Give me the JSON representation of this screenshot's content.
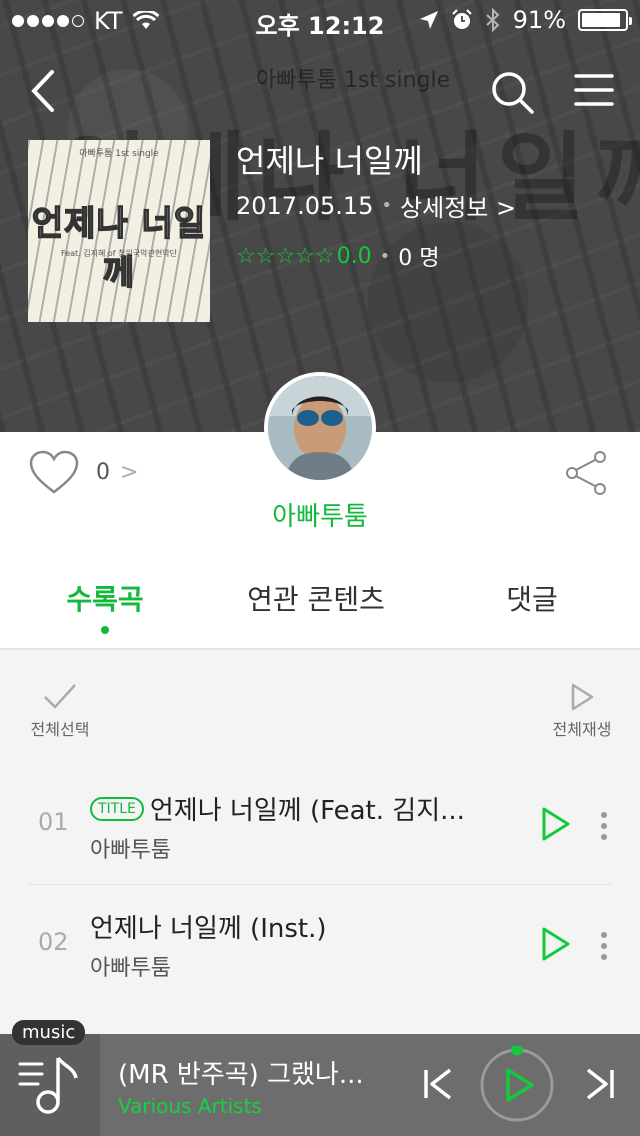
{
  "status_bar": {
    "carrier": "KT",
    "time": "오후 12:12",
    "battery": "91%",
    "battery_level": 0.91
  },
  "hero": {
    "subtitle": "아빠투툼 1st single",
    "background_text": "언제나 너일께"
  },
  "album": {
    "cover": {
      "top_text": "아빠투툼 1st single",
      "title": "언제나 너일께",
      "feat": "Feat. 김지혜 of 창원국악관현악단"
    },
    "title": "언제나 너일께",
    "release_date": "2017.05.15",
    "details_link": "상세정보 >",
    "rating": {
      "stars": "☆☆☆☆☆",
      "score": "0.0",
      "count": "0 명",
      "max": 5,
      "value": 0
    }
  },
  "social": {
    "like_count": "0",
    "like_arrow": ">",
    "artist": "아빠투툼"
  },
  "tabs": [
    {
      "label": "수록곡",
      "active": true
    },
    {
      "label": "연관 콘텐츠",
      "active": false
    },
    {
      "label": "댓글",
      "active": false
    }
  ],
  "list_controls": {
    "select_all": "전체선택",
    "play_all": "전체재생"
  },
  "tracks": [
    {
      "num": "01",
      "badge": "TITLE",
      "title": "언제나 너일께 (Feat. 김지...",
      "artist": "아빠투툼"
    },
    {
      "num": "02",
      "badge": "",
      "title": "언제나 너일께 (Inst.)",
      "artist": "아빠투툼"
    }
  ],
  "player": {
    "badge": "music",
    "title": "(MR 반주곡) 그랬나...",
    "artist": "Various Artists"
  },
  "colors": {
    "accent": "#14b83c",
    "player_bg": "#6d6d6d"
  }
}
